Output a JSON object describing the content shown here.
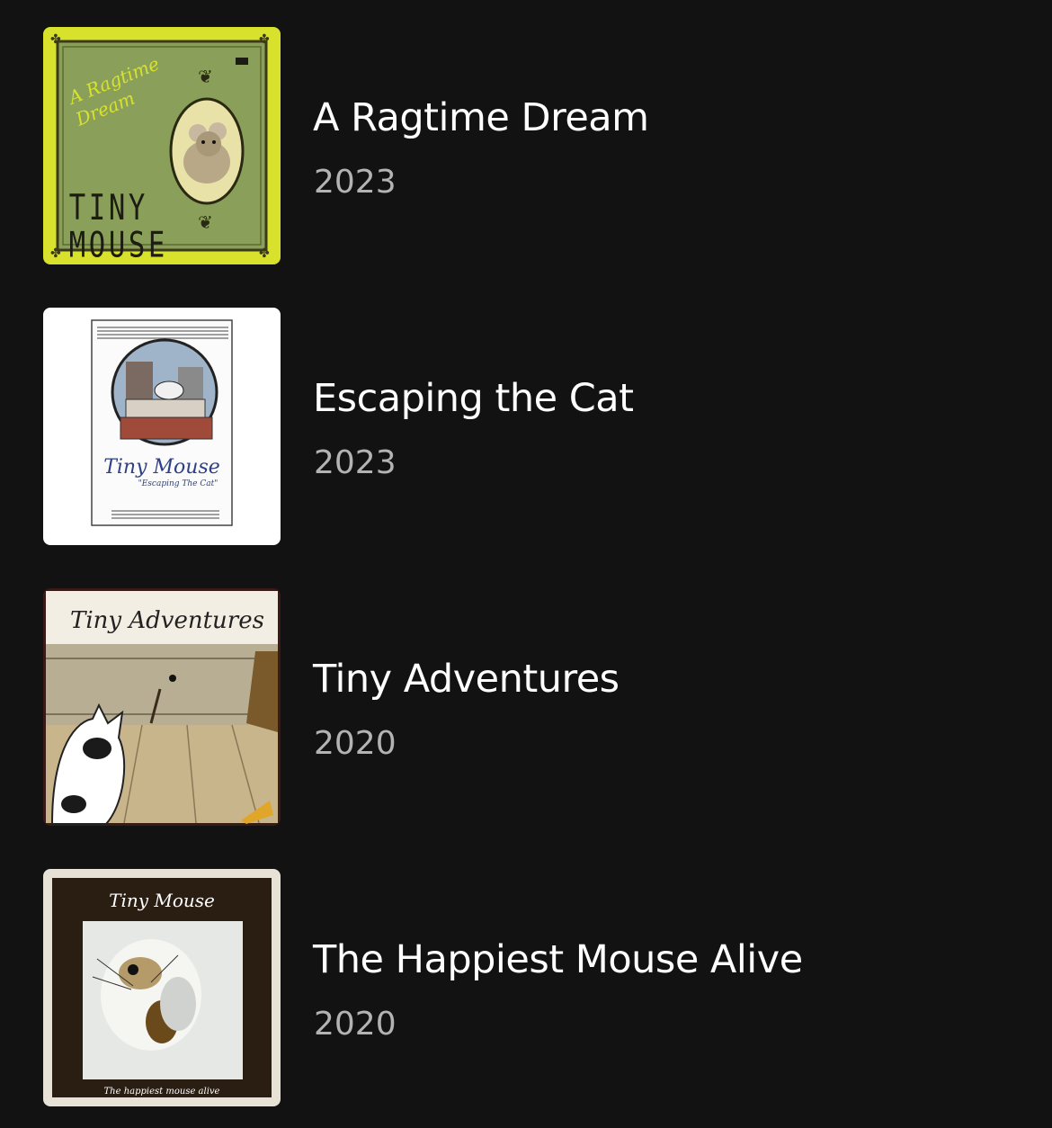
{
  "albums": [
    {
      "title": "A Ragtime Dream",
      "year": "2023",
      "cover_text": [
        "A Ragtime",
        "Dream",
        "TINY",
        "MOUSE"
      ],
      "cover_colors": {
        "frame": "#d8e22c",
        "panel": "#8aa05a",
        "ink": "#1c1c12"
      }
    },
    {
      "title": "Escaping the Cat",
      "year": "2023",
      "cover_text": [
        "Tiny Mouse",
        "\"Escaping The Cat\""
      ],
      "cover_colors": {
        "frame": "#ffffff",
        "ink": "#2a2a2a",
        "script": "#2d3f86"
      }
    },
    {
      "title": "Tiny Adventures",
      "year": "2020",
      "cover_text": [
        "Tiny Adventures"
      ],
      "cover_colors": {
        "frame": "#f3eee4",
        "wall": "#b8ae94",
        "floor": "#c9b58b"
      }
    },
    {
      "title": "The Happiest Mouse Alive",
      "year": "2020",
      "cover_text": [
        "Tiny Mouse",
        "The happiest mouse alive"
      ],
      "cover_colors": {
        "frame": "#e8e2d6",
        "panel": "#2a1d12",
        "ink": "#ffffff"
      }
    }
  ]
}
